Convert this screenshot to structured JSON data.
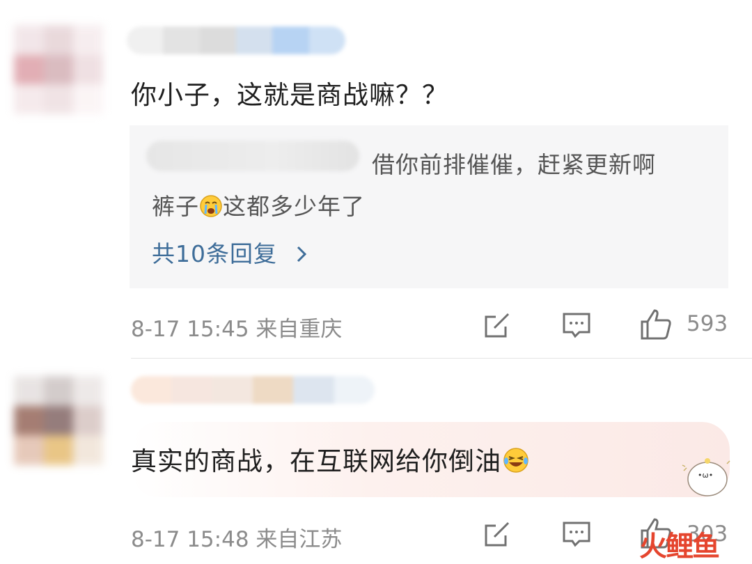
{
  "comments": [
    {
      "text": "你小子，这就是商战嘛？？",
      "reply_preview": {
        "line1": "借你前排催催，赶紧更新啊",
        "line2_prefix": "裤子",
        "line2_emoji": "crying-emoji",
        "line2_suffix": "这都多少年了",
        "more_label": "共10条回复"
      },
      "meta": "8-17 15:45  来自重庆",
      "likes": "593"
    },
    {
      "text": "真实的商战，在互联网给你倒油",
      "text_emoji": "laughing-tears-emoji",
      "meta": "8-17 15:48  来自江苏",
      "likes": "303"
    }
  ],
  "watermark": "火鲤鱼",
  "colors": {
    "link": "#3e6d99",
    "meta": "#8b8b8b",
    "reply_bg": "#f6f6f7",
    "watermark": "#e5452e"
  }
}
